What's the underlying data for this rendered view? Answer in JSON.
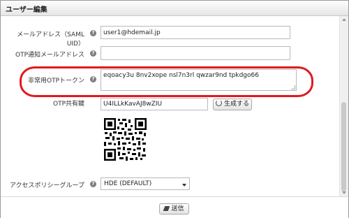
{
  "dialog": {
    "title": "ユーザー編集"
  },
  "fields": {
    "email": {
      "label": "メールアドレス（SAML UID）",
      "value": "user1@hdemail.jp"
    },
    "otp_email": {
      "label": "OTP通知メールアドレス",
      "value": ""
    },
    "emergency_token": {
      "label": "非常用OTPトークン",
      "value": "eqoacy3u 8nv2xope nsl7n3rl qwzar9nd tpkdgo66"
    },
    "otp_shared_key": {
      "label": "OTP共有鍵",
      "value": "U4ILLkKavAJ8wZIU",
      "generate_label": "生成する"
    },
    "access_policy_group": {
      "label": "アクセスポリシーグループ",
      "value": "HDE (DEFAULT)"
    }
  },
  "help_glyph": "?",
  "footer": {
    "submit_label": "送信"
  },
  "icons": [
    "help-icon",
    "refresh-icon",
    "edit-icon",
    "qr-code"
  ]
}
